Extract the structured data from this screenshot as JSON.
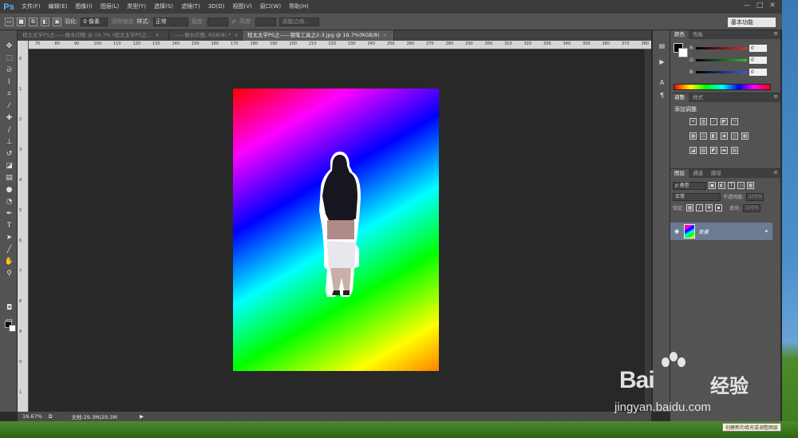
{
  "app": {
    "logo": "Ps"
  },
  "menu": [
    "文件(F)",
    "编辑(E)",
    "图像(I)",
    "图层(L)",
    "类型(Y)",
    "选择(S)",
    "滤镜(T)",
    "3D(D)",
    "视图(V)",
    "窗口(W)",
    "帮助(H)"
  ],
  "window_controls": [
    "—",
    "□",
    "✕"
  ],
  "options": {
    "feather_label": "羽化:",
    "feather_value": "0 像素",
    "antialias_label": "消除锯齿",
    "style_label": "样式:",
    "style_value": "正常",
    "width_label": "宽度:",
    "height_label": "高度:",
    "refine_edge": "调整边缘...",
    "workspace": "基本功能"
  },
  "tabs": [
    {
      "label": "程太太学PS之——做水印图 @ 16.7% (程太太学PS之...",
      "close": "×",
      "active": false
    },
    {
      "label": "——做水印图, RGB/8) *",
      "close": "×",
      "active": false
    },
    {
      "label": "程太太学PS之——钢笔工具之2-3.jpg @ 16.7%(RGB/8)",
      "close": "×",
      "active": true
    }
  ],
  "ruler_h": [
    "70",
    "80",
    "90",
    "100",
    "110",
    "120",
    "130",
    "140",
    "150",
    "160",
    "170",
    "180",
    "190",
    "200",
    "210",
    "220",
    "230",
    "240",
    "250",
    "260",
    "270",
    "280",
    "290",
    "300",
    "310",
    "320",
    "330",
    "340",
    "350",
    "360",
    "370",
    "380"
  ],
  "ruler_v": [
    "0",
    "1",
    "2",
    "3",
    "4",
    "5",
    "6",
    "7",
    "8",
    "9",
    "0",
    "1"
  ],
  "status": {
    "zoom": "16.67%",
    "doc": "文档:29.3M/29.3M"
  },
  "panels": {
    "color_tabs": [
      "颜色",
      "色板"
    ],
    "channels": [
      {
        "name": "R",
        "value": "0",
        "color": "#e03030"
      },
      {
        "name": "G",
        "value": "0",
        "color": "#30c030"
      },
      {
        "name": "B",
        "value": "0",
        "color": "#3060e0"
      }
    ],
    "adj_tabs": [
      "调整",
      "样式"
    ],
    "adj_title": "添加调整",
    "layers_tabs": [
      "图层",
      "通道",
      "路径"
    ],
    "kind_label": "ρ 类型",
    "blend_mode": "正常",
    "opacity_label": "不透明度:",
    "opacity_value": "100%",
    "lock_label": "锁定:",
    "fill_label": "填充:",
    "fill_value": "100%",
    "layer_name": "背景"
  },
  "tooltip": "创建新的填充或调整图层",
  "watermark": {
    "brand": "Bai",
    "brand_tail": "经验",
    "url": "jingyan.baidu.com"
  },
  "colors": {
    "bg": "#2b2b2b",
    "panel": "#535353",
    "accent": "#5fb4ff",
    "layer_selected": "#6b7c92"
  }
}
